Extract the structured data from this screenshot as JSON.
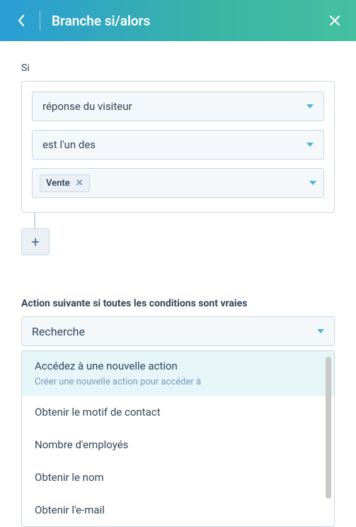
{
  "header": {
    "title": "Branche si/alors"
  },
  "condition": {
    "label": "Si",
    "field": "réponse du visiteur",
    "operator": "est l'un des",
    "tags": [
      "Vente"
    ],
    "add_label": "+"
  },
  "next_action": {
    "label": "Action suivante si toutes les conditions sont vraies",
    "search_value": "Recherche",
    "options": [
      {
        "title": "Accédez à une nouvelle action",
        "sub": "Créer une nouvelle action pour accéder à",
        "highlight": true
      },
      {
        "title": "Obtenir le motif de contact"
      },
      {
        "title": "Nombre d'employés"
      },
      {
        "title": "Obtenir le nom"
      },
      {
        "title": "Obtenir l'e-mail"
      }
    ]
  }
}
